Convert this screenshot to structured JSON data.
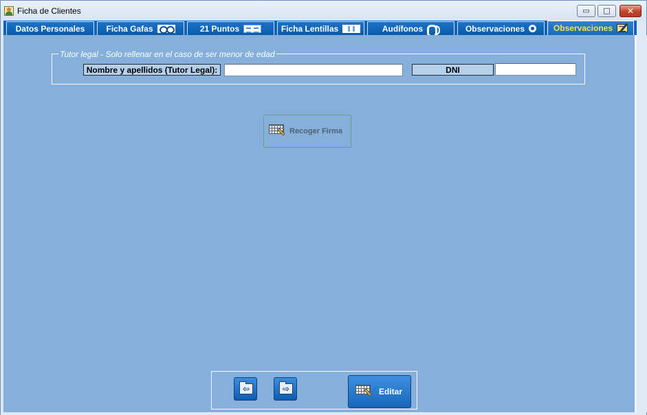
{
  "window": {
    "title": "Ficha de Clientes",
    "buttons": {
      "minimize": "▭",
      "maximize": "□",
      "close": "✕"
    }
  },
  "tabs": [
    {
      "label": "Datos Personales",
      "icon": ""
    },
    {
      "label": "Ficha Gafas",
      "icon": "glasses-icon"
    },
    {
      "label": "21 Puntos",
      "icon": "points-icon"
    },
    {
      "label": "Ficha Lentillas",
      "icon": "lens-icon"
    },
    {
      "label": "Audífonos",
      "icon": "ear-icon"
    },
    {
      "label": "Observaciones",
      "icon": "dot-icon"
    },
    {
      "label": "Observaciones",
      "icon": "note-icon",
      "active": true
    }
  ],
  "tutor": {
    "legend": "Tutor legal - Solo rellenar en el caso de ser menor de edad",
    "name_label": "Nombre y apellidos (Tutor Legal):",
    "name_value": "",
    "dni_label": "DNI",
    "dni_value": ""
  },
  "actions": {
    "sign_label": "Recoger Firma",
    "edit_label": "Editar",
    "prev_glyph": "⇦",
    "next_glyph": "⇨"
  },
  "colors": {
    "tab_bar": "#0a63b8",
    "active_tab_text": "#ffe23a",
    "content_background": "#86b0dc",
    "label_background": "#b6d0ec"
  }
}
